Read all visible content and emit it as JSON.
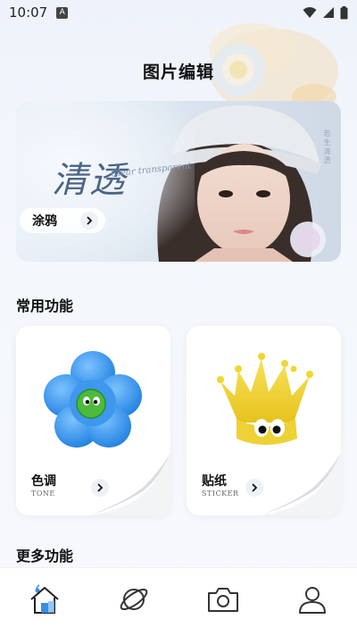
{
  "status_bar": {
    "time": "10:07",
    "notification_letter": "A"
  },
  "page": {
    "title": "图片编辑"
  },
  "banner": {
    "title": "清透",
    "script_text": "Clear transparent",
    "side_text": "若生清透",
    "button_label": "涂鸦"
  },
  "sections": {
    "common": "常用功能",
    "more": "更多功能"
  },
  "cards": [
    {
      "label": "色调",
      "sub": "TONE",
      "icon": "blue-flower-icon"
    },
    {
      "label": "贴纸",
      "sub": "STICKER",
      "icon": "yellow-crown-icon"
    }
  ],
  "bottom_nav": [
    {
      "name": "home",
      "icon": "home-icon",
      "active": true
    },
    {
      "name": "discover",
      "icon": "planet-icon",
      "active": false
    },
    {
      "name": "camera",
      "icon": "camera-icon",
      "active": false
    },
    {
      "name": "profile",
      "icon": "user-icon",
      "active": false
    }
  ],
  "colors": {
    "accent_blue": "#3a8ee6",
    "nav_icon": "#333333",
    "banner_title": "#4a6485"
  }
}
